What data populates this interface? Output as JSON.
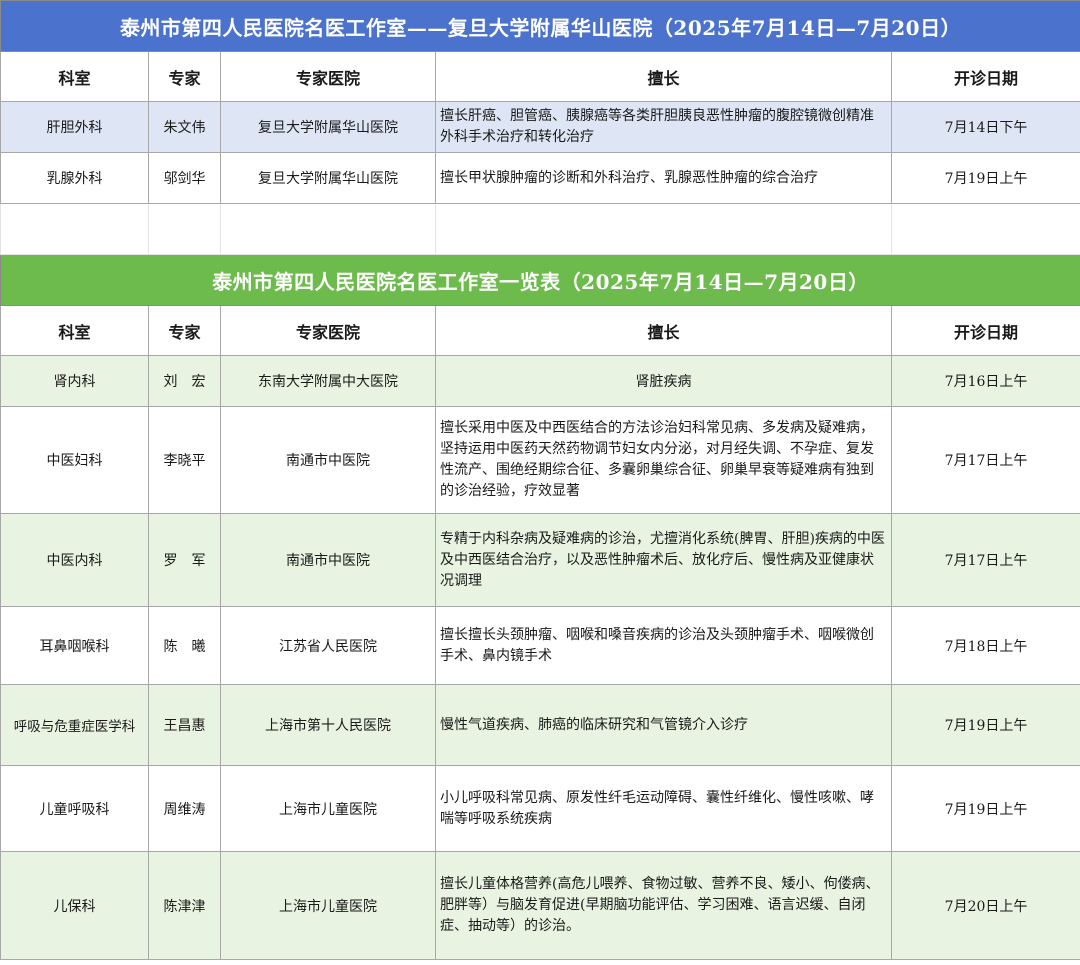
{
  "section1": {
    "title": "泰州市第四人民医院名医工作室——复旦大学附属华山医院（2025年7月14日—7月20日）",
    "headers": [
      "科室",
      "专家",
      "专家医院",
      "擅长",
      "开诊日期"
    ],
    "rows": [
      {
        "dept": "肝胆外科",
        "doctor": "朱文伟",
        "hospital": "复旦大学附属华山医院",
        "specialty": "擅长肝癌、胆管癌、胰腺癌等各类肝胆胰良恶性肿瘤的腹腔镜微创精准外科手术治疗和转化治疗",
        "date": "7月14日下午"
      },
      {
        "dept": "乳腺外科",
        "doctor": "邬剑华",
        "hospital": "复旦大学附属华山医院",
        "specialty": "擅长甲状腺肿瘤的诊断和外科治疗、乳腺恶性肿瘤的综合治疗",
        "date": "7月19日上午"
      }
    ]
  },
  "section2": {
    "title": "泰州市第四人民医院名医工作室一览表（2025年7月14日—7月20日）",
    "headers": [
      "科室",
      "专家",
      "专家医院",
      "擅长",
      "开诊日期"
    ],
    "rows": [
      {
        "dept": "肾内科",
        "doctor": "刘　宏",
        "hospital": "东南大学附属中大医院",
        "specialty": "肾脏疾病",
        "date": "7月16日上午"
      },
      {
        "dept": "中医妇科",
        "doctor": "李晓平",
        "hospital": "南通市中医院",
        "specialty": "擅长采用中医及中西医结合的方法诊治妇科常见病、多发病及疑难病，坚持运用中医药天然药物调节妇女内分泌，对月经失调、不孕症、复发性流产、围绝经期综合征、多囊卵巢综合征、卵巢早衰等疑难病有独到的诊治经验，疗效显著",
        "date": "7月17日上午"
      },
      {
        "dept": "中医内科",
        "doctor": "罗　军",
        "hospital": "南通市中医院",
        "specialty": "专精于内科杂病及疑难病的诊治，尤擅消化系统(脾胃、肝胆)疾病的中医及中西医结合治疗，以及恶性肿瘤术后、放化疗后、慢性病及亚健康状况调理",
        "date": "7月17日上午"
      },
      {
        "dept": "耳鼻咽喉科",
        "doctor": "陈　曦",
        "hospital": "江苏省人民医院",
        "specialty": "擅长擅长头颈肿瘤、咽喉和嗓音疾病的诊治及头颈肿瘤手术、咽喉微创手术、鼻内镜手术",
        "date": "7月18日上午"
      },
      {
        "dept": "呼吸与危重症医学科",
        "doctor": "王昌惠",
        "hospital": "上海市第十人民医院",
        "specialty": "慢性气道疾病、肺癌的临床研究和气管镜介入诊疗",
        "date": "7月19日上午"
      },
      {
        "dept": "儿童呼吸科",
        "doctor": "周维涛",
        "hospital": "上海市儿童医院",
        "specialty": "小儿呼吸科常见病、原发性纤毛运动障碍、囊性纤维化、慢性咳嗽、哮喘等呼吸系统疾病",
        "date": "7月19日上午"
      },
      {
        "dept": "儿保科",
        "doctor": "陈津津",
        "hospital": "上海市儿童医院",
        "specialty": "擅长儿童体格营养(高危儿喂养、食物过敏、营养不良、矮小、佝偻病、肥胖等）与脑发育促进(早期脑功能评估、学习困难、语言迟缓、自闭症、抽动等）的诊治。",
        "date": "7月20日上午"
      }
    ]
  }
}
